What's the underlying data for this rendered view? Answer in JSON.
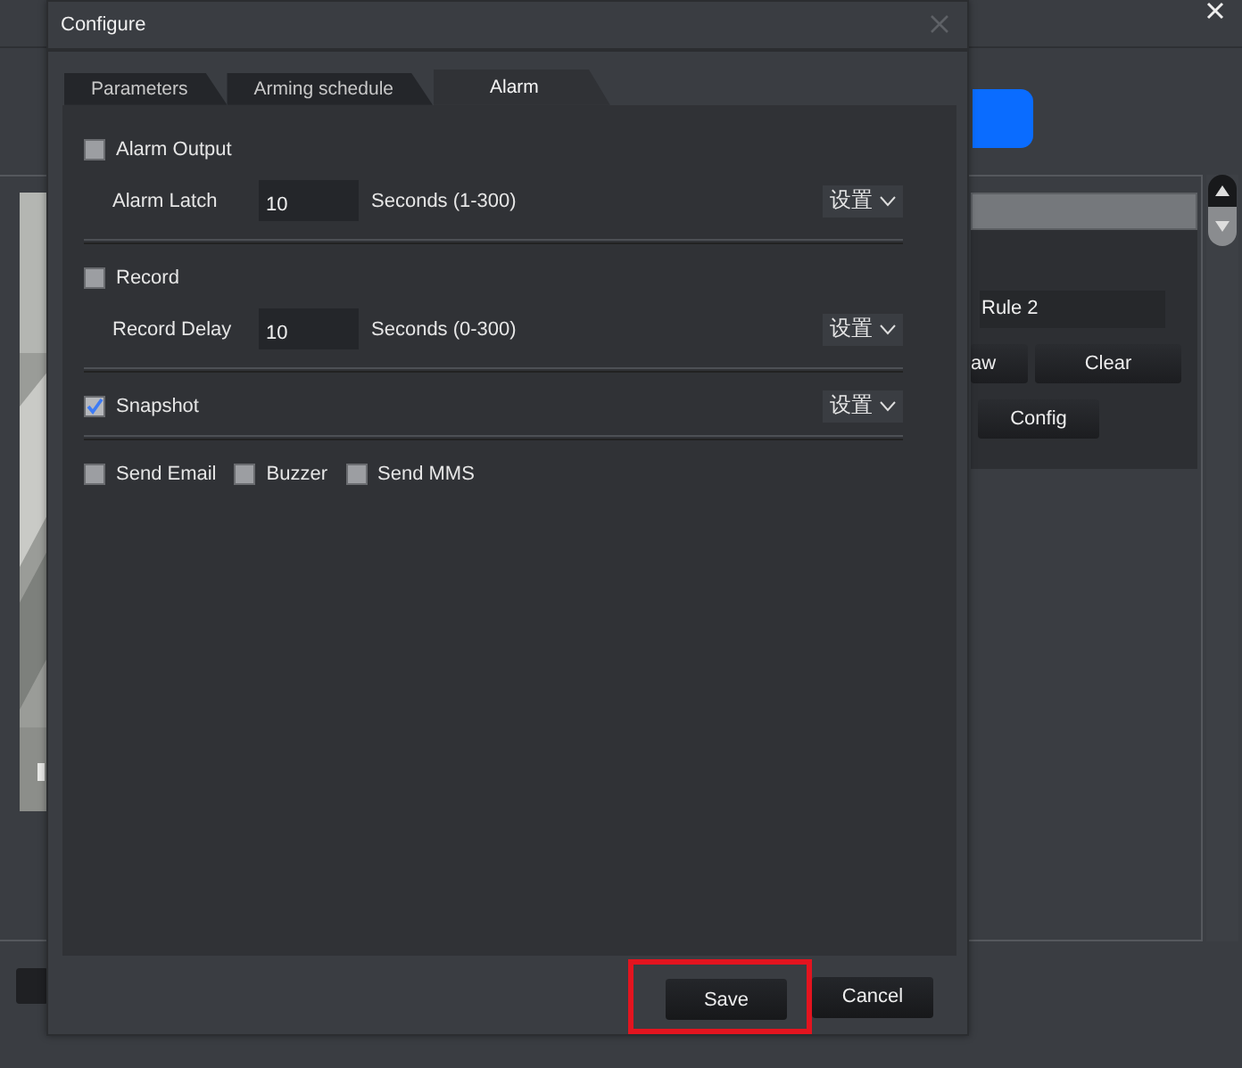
{
  "background": {
    "rule_field": "Rule 2",
    "buttons": [
      "aw",
      "Clear",
      "Config"
    ]
  },
  "window": {
    "title": "Configure"
  },
  "tabs": [
    {
      "label": "Parameters",
      "selected": false
    },
    {
      "label": "Arming schedule",
      "selected": false
    },
    {
      "label": "Alarm",
      "selected": true
    }
  ],
  "sections": [
    {
      "kind": "timed",
      "checkbox": {
        "label": "Alarm Output",
        "checked": false
      },
      "field": {
        "label": "Alarm Latch",
        "value": "10",
        "unit": "Seconds (1-300)"
      },
      "dropdown": "设置"
    },
    {
      "kind": "timed",
      "checkbox": {
        "label": "Record",
        "checked": false
      },
      "field": {
        "label": "Record Delay",
        "value": "10",
        "unit": "Seconds (0-300)"
      },
      "dropdown": "设置"
    },
    {
      "kind": "simple",
      "checkbox": {
        "label": "Snapshot",
        "checked": true
      },
      "dropdown": "设置"
    },
    {
      "kind": "options",
      "options": [
        {
          "label": "Send Email",
          "checked": false
        },
        {
          "label": "Buzzer",
          "checked": false
        },
        {
          "label": "Send MMS",
          "checked": false
        }
      ]
    }
  ],
  "buttons": [
    {
      "label": "Save",
      "highlighted": true
    },
    {
      "label": "Cancel",
      "highlighted": false
    }
  ]
}
